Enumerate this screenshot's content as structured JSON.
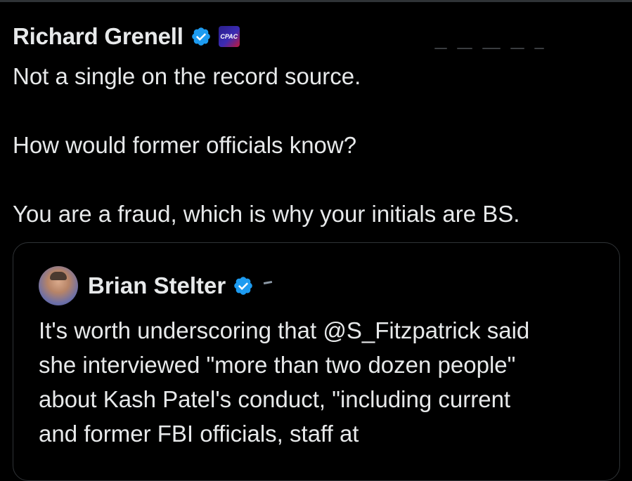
{
  "post": {
    "author_name": "Richard Grenell",
    "verified_icon": "verified-badge-icon",
    "affiliation_icon": "affiliation-badge-icon",
    "affiliation_badge_text": "CPAC",
    "text_lines": [
      "Not a single on the record source.",
      "How would former officials know?",
      "You are a fraud, which is why your initials are BS."
    ]
  },
  "quoted_post": {
    "author_name": "Brian Stelter",
    "verified_icon": "verified-badge-icon",
    "text_lines": [
      "It's worth underscoring that @S_Fitzpatrick said",
      "she interviewed \"more than two dozen people\"",
      "about Kash Patel's conduct, \"including current",
      "and former FBI officials, staff at"
    ]
  },
  "colors": {
    "background": "#000000",
    "text": "#e7e9ea",
    "verified_blue": "#1d9bf0",
    "border": "#2f3336"
  }
}
